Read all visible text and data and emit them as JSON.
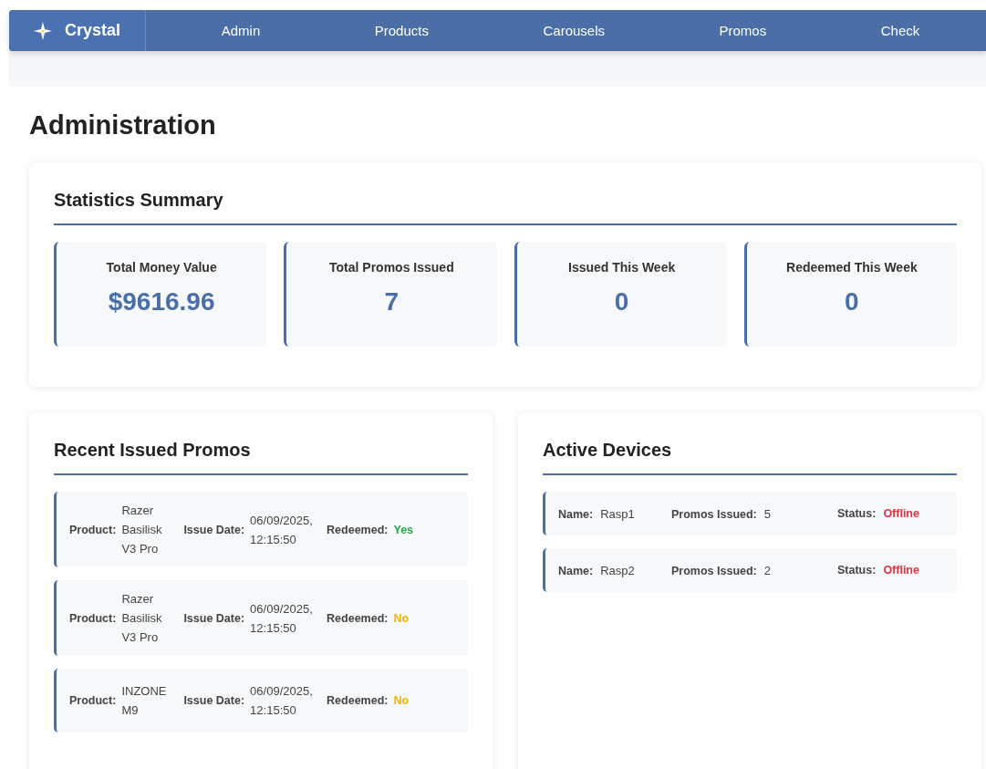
{
  "navbar": {
    "brand": "Crystal",
    "items": [
      {
        "label": "Admin"
      },
      {
        "label": "Products"
      },
      {
        "label": "Carousels"
      },
      {
        "label": "Promos"
      },
      {
        "label": "Check"
      }
    ]
  },
  "page_title": "Administration",
  "statistics": {
    "title": "Statistics Summary",
    "stats": [
      {
        "label": "Total Money Value",
        "value": "$9616.96"
      },
      {
        "label": "Total Promos Issued",
        "value": "7"
      },
      {
        "label": "Issued This Week",
        "value": "0"
      },
      {
        "label": "Redeemed This Week",
        "value": "0"
      }
    ]
  },
  "recent_promos": {
    "title": "Recent Issued Promos",
    "rows": [
      {
        "product_label": "Product:",
        "product": "Razer Basilisk V3 Pro",
        "date_label": "Issue Date:",
        "date": "06/09/2025, 12:15:50",
        "redeemed_label": "Redeemed:",
        "redeemed_text": "Yes",
        "redeemed": true
      },
      {
        "product_label": "Product:",
        "product": "Razer Basilisk V3 Pro",
        "date_label": "Issue Date:",
        "date": "06/09/2025, 12:15:50",
        "redeemed_label": "Redeemed:",
        "redeemed_text": "No",
        "redeemed": false
      },
      {
        "product_label": "Product:",
        "product": "INZONE M9",
        "date_label": "Issue Date:",
        "date": "06/09/2025, 12:15:50",
        "redeemed_label": "Redeemed:",
        "redeemed_text": "No",
        "redeemed": false
      }
    ]
  },
  "active_devices": {
    "title": "Active Devices",
    "rows": [
      {
        "name_label": "Name:",
        "name": "Rasp1",
        "issued_label": "Promos Issued:",
        "issued": "5",
        "status_label": "Status:",
        "status_text": "Offline",
        "online": false
      },
      {
        "name_label": "Name:",
        "name": "Rasp2",
        "issued_label": "Promos Issued:",
        "issued": "2",
        "status_label": "Status:",
        "status_text": "Offline",
        "online": false
      }
    ]
  }
}
